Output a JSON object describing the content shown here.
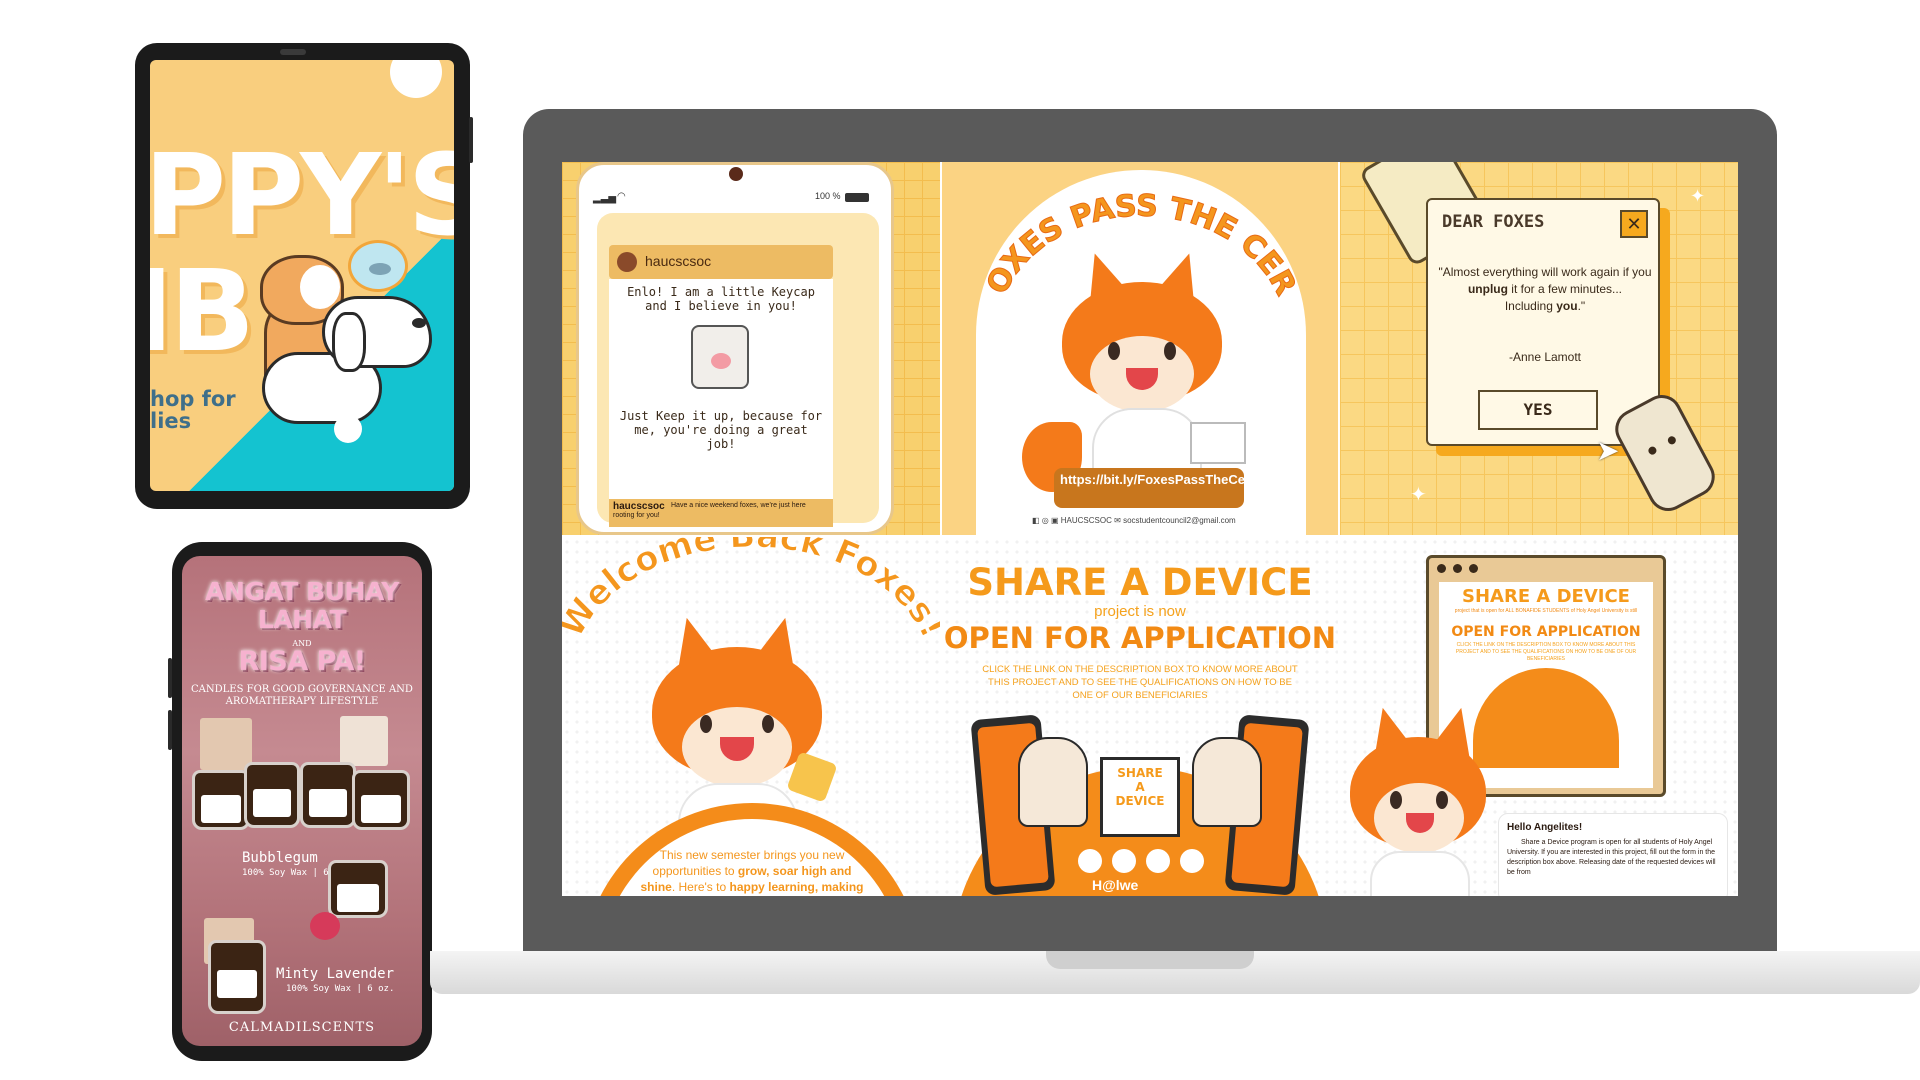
{
  "tablet": {
    "title_line1": "PPY'S",
    "title_line2": "IB",
    "subtitle_line1": "hop for",
    "subtitle_line2": "lies"
  },
  "phone": {
    "headline1": "ANGAT BUHAY",
    "headline2": "LAHAT",
    "and": "AND",
    "headline3": "RISA PA!",
    "tagline1": "CANDLES FOR GOOD GOVERNANCE AND",
    "tagline2": "AROMATHERAPY LIFESTYLE",
    "product1_name": "Bubblegum",
    "product1_detail": "100% Soy Wax | 6 oz.",
    "product2_name": "Minty Lavender",
    "product2_detail": "100% Soy Wax | 6 oz.",
    "brand": "CALMADILSCENTS"
  },
  "laptop_posts": {
    "keycap": {
      "status_battery": "100 %",
      "handle": "haucscsoc",
      "message1": "Enlo! I am a little Keycap and I believe in you!",
      "message2": "Just Keep it up, because for me, you're doing a great job!",
      "reply_handle": "haucscsoc",
      "reply_text": "Have a nice weekend foxes, we're just here rooting for you!"
    },
    "cert": {
      "title": "FOXES PASS THE CERT",
      "link": "https://bit.ly/FoxesPassTheCertForm",
      "footer_handle": "HAUCSCSOC",
      "footer_email": "socstudentcouncil2@gmail.com"
    },
    "dear_foxes": {
      "title": "DEAR FOXES",
      "quote1": "\"Almost everything will work again if you",
      "quote_bold1": "unplug",
      "quote2": "it for a few minutes...",
      "quote3": "Including",
      "quote_bold2": "you",
      "quote4": ".\"",
      "author": "-Anne Lamott",
      "button": "YES"
    },
    "welcome": {
      "title": "Welcome Back Foxes!",
      "body1": "This new semester brings you new",
      "body2": "opportunities to",
      "bold1": "grow, soar high and",
      "bold2": "shine",
      "body3": ". Here's to",
      "bold3": "happy learning, making"
    },
    "share_device": {
      "line1": "SHARE A DEVICE",
      "line2": "project is now",
      "line3": "OPEN FOR APPLICATION",
      "body": "CLICK THE LINK ON THE DESCRIPTION BOX TO KNOW MORE ABOUT THIS PROJECT AND TO SEE THE QUALIFICATIONS ON HOW TO BE ONE OF OUR BENEFICIARIES",
      "screen_line1": "SHARE",
      "screen_line2": "A",
      "screen_line3": "DEVICE",
      "footer_logo": "H@lwe"
    },
    "share_device_2": {
      "line1": "SHARE A DEVICE",
      "small1": "project that is open for ALL BONAFIDE STUDENTS of Holy Angel University is still",
      "line3": "OPEN FOR APPLICATION",
      "small2": "CLICK THE LINK ON THE DESCRIPTION BOX TO KNOW MORE ABOUT THIS PROJECT AND TO SEE THE QUALIFICATIONS ON HOW TO BE ONE OF OUR BENEFICIARIES",
      "card_title": "Hello Angelites!",
      "card_text": "Share a Device program is open for all students of Holy Angel University. If you are interested in this project, fill out the form in the description box above. Releasing date of the requested devices will be from"
    }
  }
}
